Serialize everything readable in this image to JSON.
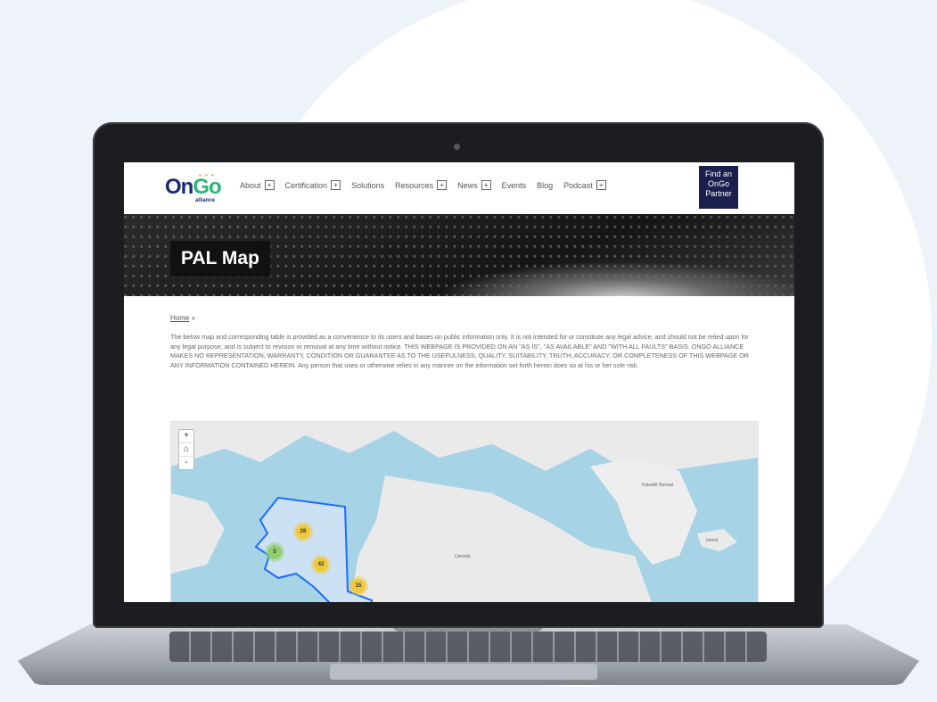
{
  "logo": {
    "on": "On",
    "go": "Go",
    "sub": "alliance",
    "dots": "• • •"
  },
  "nav": [
    {
      "label": "About",
      "expandable": true
    },
    {
      "label": "Certification",
      "expandable": true
    },
    {
      "label": "Solutions",
      "expandable": false
    },
    {
      "label": "Resources",
      "expandable": true
    },
    {
      "label": "News",
      "expandable": true
    },
    {
      "label": "Events",
      "expandable": false
    },
    {
      "label": "Blog",
      "expandable": false
    },
    {
      "label": "Podcast",
      "expandable": true
    }
  ],
  "plus_symbol": "+",
  "cta": {
    "line1": "Find an",
    "line2": "OnGo",
    "line3": "Partner"
  },
  "hero": {
    "title": "PAL Map"
  },
  "breadcrumb": {
    "home": "Home",
    "separator": "»"
  },
  "disclaimer": "The below map and corresponding table is provided as a convenience to its users and bases on public information only. It is not intended for or constitute any legal advice, and should not be relied upon for any legal purpose, and is subject to revision or removal at any time without notice. THIS WEBPAGE IS PROVIDED ON AN \"AS IS\", \"AS AVAILABLE\" AND \"WITH ALL FAULTS\" BASIS. ONGO ALLIANCE MAKES NO REPRESENTATION, WARRANTY, CONDITION OR GUARANTEE AS TO THE USEFULNESS, QUALITY, SUITABILITY, TRUTH, ACCURACY, OR COMPLETENESS OF THIS WEBPAGE OR ANY INFORMATION CONTAINED HEREIN. Any person that uses or otherwise relies in any manner on the information set forth herein does so at his or her sole risk.",
  "map": {
    "zoom_in": "+",
    "home": "⌂",
    "zoom_out": "-",
    "clusters": [
      "28",
      "5",
      "42",
      "15"
    ],
    "labels": {
      "kalaallit": "Kalaallit Nunaat",
      "iceland": "Ísland",
      "canada": "Canada"
    },
    "colors": {
      "water": "#a6d3e6",
      "land": "#eaeaea",
      "alaska_fill": "#cde1f4",
      "alaska_border": "#1e6bff"
    }
  }
}
